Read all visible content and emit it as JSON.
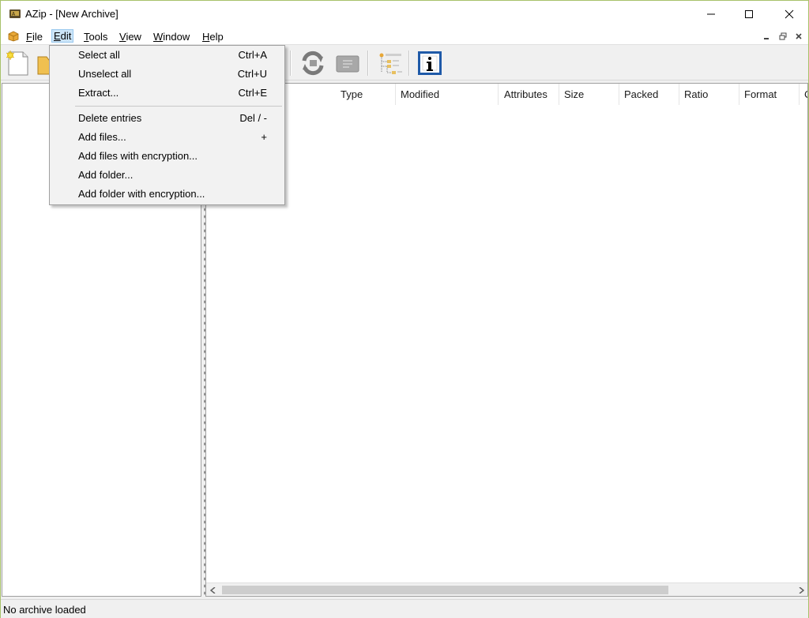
{
  "window": {
    "title": "AZip - [New Archive]",
    "controls": {
      "minimize": "—",
      "maximize": "☐",
      "close": "✕"
    }
  },
  "menubar": {
    "items": [
      {
        "label": "File",
        "underline": "F",
        "rest": "ile"
      },
      {
        "label": "Edit",
        "underline": "E",
        "rest": "dit"
      },
      {
        "label": "Tools",
        "underline": "T",
        "rest": "ools"
      },
      {
        "label": "View",
        "underline": "V",
        "rest": "iew"
      },
      {
        "label": "Window",
        "underline": "W",
        "rest": "indow"
      },
      {
        "label": "Help",
        "underline": "H",
        "rest": "elp"
      }
    ],
    "active_menu": "Edit",
    "mdi_controls": {
      "minimize": "_",
      "restore": "🗗",
      "close": "×"
    }
  },
  "toolbar": {
    "buttons": [
      "new-archive-icon",
      "open-archive-icon",
      "recompress-icon",
      "test-archive-icon",
      "tree-view-icon",
      "properties-icon"
    ]
  },
  "list": {
    "columns": [
      {
        "label": "Type"
      },
      {
        "label": "Modified"
      },
      {
        "label": "Attributes"
      },
      {
        "label": "Size"
      },
      {
        "label": "Packed"
      },
      {
        "label": "Ratio"
      },
      {
        "label": "Format"
      },
      {
        "label": "C"
      }
    ]
  },
  "edit_menu": {
    "items": [
      {
        "label": "Select all",
        "shortcut": "Ctrl+A"
      },
      {
        "label": "Unselect all",
        "shortcut": "Ctrl+U"
      },
      {
        "label": "Extract...",
        "shortcut": "Ctrl+E"
      },
      {
        "label": "Delete entries",
        "shortcut": "Del / -"
      },
      {
        "label": "Add files...",
        "shortcut": "+"
      },
      {
        "label": "Add files with encryption...",
        "shortcut": ""
      },
      {
        "label": "Add folder...",
        "shortcut": ""
      },
      {
        "label": "Add folder with encryption...",
        "shortcut": ""
      }
    ]
  },
  "statusbar": {
    "text": "No archive loaded"
  },
  "colors": {
    "menu_highlight": "#cce4f7",
    "window_border": "#a8c26a",
    "info_icon_blue": "#1f5aa8"
  }
}
